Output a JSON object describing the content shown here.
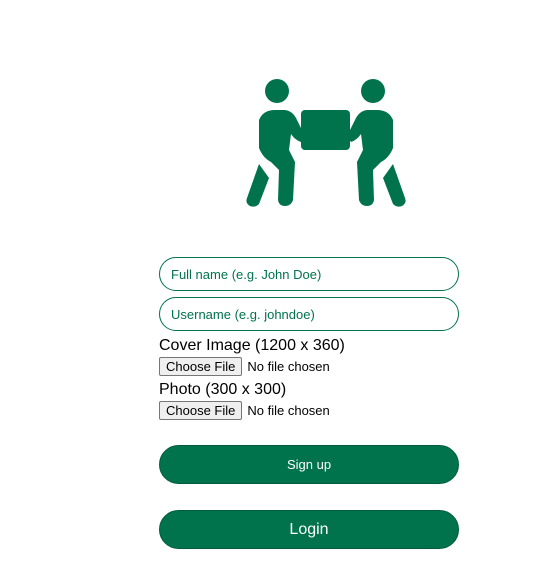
{
  "logo": {
    "icon": "people-carrying-box-icon",
    "color": "#00734d"
  },
  "form": {
    "full_name_placeholder": "Full name (e.g. John Doe)",
    "username_placeholder": "Username (e.g. johndoe)",
    "cover_image_label": "Cover Image (1200 x 360)",
    "photo_label": "Photo (300 x 300)",
    "choose_file_label": "Choose File",
    "no_file_text": "No file chosen"
  },
  "actions": {
    "signup_label": "Sign up",
    "login_label": "Login"
  },
  "colors": {
    "accent": "#00734d"
  }
}
